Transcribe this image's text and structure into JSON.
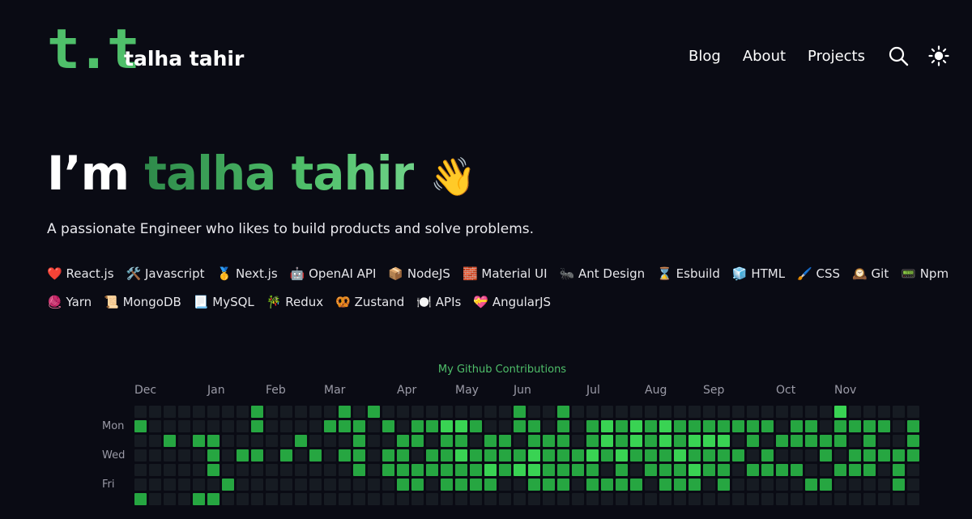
{
  "header": {
    "logo_text": "t.t",
    "site_name": "talha tahir",
    "nav": [
      {
        "label": "Blog"
      },
      {
        "label": "About"
      },
      {
        "label": "Projects"
      }
    ],
    "icons": {
      "search": "search-icon",
      "theme": "sun-icon"
    }
  },
  "hero": {
    "greeting": "I’m ",
    "name": "talha tahir",
    "emoji": "👋",
    "tagline": "A passionate Engineer who likes to build products and solve problems."
  },
  "skills": [
    {
      "icon": "❤️",
      "label": "React.js"
    },
    {
      "icon": "🛠️",
      "label": "Javascript"
    },
    {
      "icon": "🥇",
      "label": "Next.js"
    },
    {
      "icon": "🤖",
      "label": "OpenAI API"
    },
    {
      "icon": "📦",
      "label": "NodeJS"
    },
    {
      "icon": "🧱",
      "label": "Material UI"
    },
    {
      "icon": "🐜",
      "label": "Ant Design"
    },
    {
      "icon": "⌛",
      "label": "Esbuild"
    },
    {
      "icon": "🧊",
      "label": "HTML"
    },
    {
      "icon": "🖌️",
      "label": "CSS"
    },
    {
      "icon": "🕰️",
      "label": "Git"
    },
    {
      "icon": "📟",
      "label": "Npm"
    },
    {
      "icon": "🧶",
      "label": "Yarn"
    },
    {
      "icon": "📜",
      "label": "MongoDB"
    },
    {
      "icon": "📃",
      "label": "MySQL"
    },
    {
      "icon": "🎋",
      "label": "Redux"
    },
    {
      "icon": "🥨",
      "label": "Zustand"
    },
    {
      "icon": "🍽️",
      "label": "APIs"
    },
    {
      "icon": "💝",
      "label": "AngularJS"
    }
  ],
  "contributions": {
    "title": "My Github Contributions",
    "months": [
      {
        "label": "Dec",
        "week": 0
      },
      {
        "label": "Jan",
        "week": 5
      },
      {
        "label": "Feb",
        "week": 9
      },
      {
        "label": "Mar",
        "week": 13
      },
      {
        "label": "Apr",
        "week": 18
      },
      {
        "label": "May",
        "week": 22
      },
      {
        "label": "Jun",
        "week": 26
      },
      {
        "label": "Jul",
        "week": 31
      },
      {
        "label": "Aug",
        "week": 35
      },
      {
        "label": "Sep",
        "week": 39
      },
      {
        "label": "Oct",
        "week": 44
      },
      {
        "label": "Nov",
        "week": 48
      }
    ],
    "day_labels": [
      {
        "label": "Mon",
        "row": 1
      },
      {
        "label": "Wed",
        "row": 3
      },
      {
        "label": "Fri",
        "row": 5
      }
    ],
    "level_colors": [
      "#161b22",
      "#0e4429",
      "#26a641",
      "#39d353",
      "#7fd88f"
    ],
    "weeks": [
      [
        0,
        2,
        0,
        0,
        0,
        0,
        2
      ],
      [
        0,
        0,
        0,
        0,
        0,
        0,
        0
      ],
      [
        0,
        0,
        2,
        0,
        0,
        0,
        0
      ],
      [
        0,
        0,
        0,
        0,
        0,
        0,
        0
      ],
      [
        0,
        0,
        2,
        0,
        0,
        0,
        2
      ],
      [
        0,
        0,
        2,
        2,
        2,
        0,
        2
      ],
      [
        0,
        0,
        0,
        0,
        0,
        2,
        0
      ],
      [
        0,
        0,
        0,
        2,
        0,
        0,
        0
      ],
      [
        2,
        2,
        0,
        2,
        0,
        0,
        0
      ],
      [
        0,
        0,
        0,
        0,
        0,
        0,
        0
      ],
      [
        0,
        0,
        0,
        2,
        0,
        0,
        0
      ],
      [
        0,
        0,
        2,
        0,
        0,
        0,
        0
      ],
      [
        0,
        0,
        0,
        2,
        0,
        0,
        0
      ],
      [
        0,
        2,
        0,
        0,
        0,
        0,
        0
      ],
      [
        2,
        2,
        0,
        2,
        0,
        0,
        0
      ],
      [
        0,
        2,
        2,
        2,
        2,
        0,
        0
      ],
      [
        2,
        0,
        0,
        0,
        0,
        0,
        0
      ],
      [
        0,
        2,
        0,
        2,
        2,
        0,
        0
      ],
      [
        0,
        0,
        2,
        2,
        2,
        2,
        0
      ],
      [
        0,
        2,
        2,
        0,
        2,
        2,
        0
      ],
      [
        0,
        2,
        0,
        2,
        2,
        0,
        0
      ],
      [
        0,
        3,
        2,
        2,
        2,
        2,
        0
      ],
      [
        0,
        3,
        2,
        3,
        2,
        2,
        0
      ],
      [
        0,
        2,
        0,
        2,
        2,
        2,
        0
      ],
      [
        0,
        0,
        2,
        2,
        3,
        2,
        0
      ],
      [
        0,
        0,
        2,
        2,
        2,
        0,
        0
      ],
      [
        2,
        2,
        0,
        2,
        3,
        0,
        0
      ],
      [
        0,
        2,
        2,
        3,
        3,
        2,
        0
      ],
      [
        0,
        0,
        2,
        2,
        2,
        2,
        0
      ],
      [
        2,
        2,
        2,
        2,
        2,
        2,
        0
      ],
      [
        0,
        0,
        0,
        2,
        2,
        0,
        0
      ],
      [
        0,
        2,
        2,
        3,
        2,
        2,
        0
      ],
      [
        0,
        3,
        3,
        2,
        0,
        2,
        0
      ],
      [
        0,
        2,
        2,
        3,
        2,
        2,
        0
      ],
      [
        0,
        3,
        3,
        2,
        0,
        2,
        0
      ],
      [
        0,
        2,
        2,
        2,
        2,
        0,
        0
      ],
      [
        0,
        3,
        3,
        2,
        2,
        2,
        0
      ],
      [
        0,
        2,
        2,
        3,
        2,
        2,
        0
      ],
      [
        0,
        2,
        3,
        2,
        3,
        2,
        0
      ],
      [
        0,
        2,
        3,
        2,
        2,
        0,
        0
      ],
      [
        0,
        2,
        3,
        2,
        2,
        2,
        0
      ],
      [
        0,
        2,
        0,
        2,
        0,
        0,
        0
      ],
      [
        0,
        2,
        2,
        0,
        2,
        0,
        0
      ],
      [
        0,
        2,
        0,
        2,
        2,
        0,
        0
      ],
      [
        0,
        0,
        2,
        0,
        2,
        0,
        0
      ],
      [
        0,
        2,
        2,
        0,
        2,
        0,
        0
      ],
      [
        0,
        2,
        2,
        0,
        0,
        2,
        0
      ],
      [
        0,
        0,
        2,
        2,
        0,
        2,
        0
      ],
      [
        3,
        2,
        2,
        0,
        2,
        0,
        0
      ],
      [
        0,
        2,
        0,
        2,
        2,
        0,
        0
      ],
      [
        0,
        2,
        2,
        2,
        2,
        0,
        0
      ],
      [
        0,
        2,
        0,
        2,
        0,
        0,
        0
      ],
      [
        0,
        0,
        0,
        2,
        2,
        2,
        0
      ],
      [
        0,
        2,
        2,
        2,
        0,
        0,
        0
      ]
    ]
  }
}
